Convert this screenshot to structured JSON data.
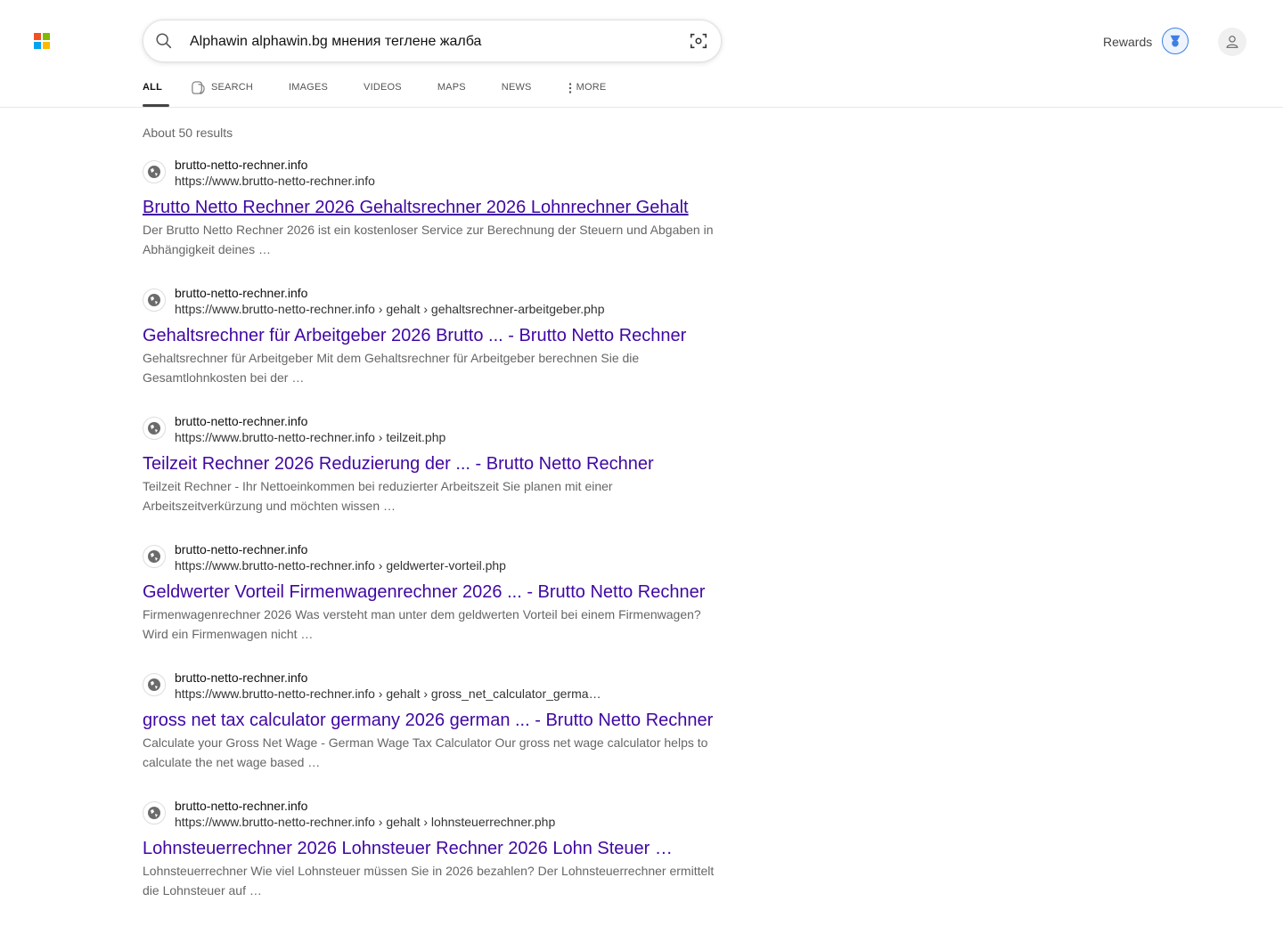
{
  "header": {
    "search_query": "Alphawin alphawin.bg мнения теглене жалба",
    "rewards_label": "Rewards"
  },
  "colors": {
    "logo": [
      "#f25022",
      "#7fba00",
      "#00a4ef",
      "#ffb900"
    ],
    "link": "#4007a2",
    "rewards_accent": "#3f7fe5"
  },
  "tabs": [
    {
      "label": "ALL",
      "icon": ""
    },
    {
      "label": "SEARCH",
      "icon": "copilot-icon"
    },
    {
      "label": "IMAGES",
      "icon": ""
    },
    {
      "label": "VIDEOS",
      "icon": ""
    },
    {
      "label": "MAPS",
      "icon": ""
    },
    {
      "label": "NEWS",
      "icon": ""
    },
    {
      "label": "MORE",
      "icon": "kebab-icon"
    }
  ],
  "results_count": "About 50 results",
  "results": [
    {
      "site": "brutto-netto-rechner.info",
      "url": "https://www.brutto-netto-rechner.info",
      "title": "Brutto Netto Rechner 2026 Gehaltsrechner 2026 Lohnrechner Gehalt",
      "snippet": "Der Brutto Netto Rechner 2026 ist ein kostenloser Service zur Berechnung der Steuern und Abgaben in Abhängigkeit deines …"
    },
    {
      "site": "brutto-netto-rechner.info",
      "url": "https://www.brutto-netto-rechner.info › gehalt › gehaltsrechner-arbeitgeber.php",
      "title": "Gehaltsrechner für Arbeitgeber 2026 Brutto ... - Brutto Netto Rechner",
      "snippet": "Gehaltsrechner für Arbeitgeber Mit dem Gehaltsrechner für Arbeitgeber berechnen Sie die Gesamtlohnkosten bei der …"
    },
    {
      "site": "brutto-netto-rechner.info",
      "url": "https://www.brutto-netto-rechner.info › teilzeit.php",
      "title": "Teilzeit Rechner 2026 Reduzierung der ... - Brutto Netto Rechner",
      "snippet": "Teilzeit Rechner - Ihr Nettoeinkommen bei reduzierter Arbeitszeit Sie planen mit einer Arbeitszeitverkürzung und möchten wissen …"
    },
    {
      "site": "brutto-netto-rechner.info",
      "url": "https://www.brutto-netto-rechner.info › geldwerter-vorteil.php",
      "title": "Geldwerter Vorteil Firmenwagenrechner 2026 ... - Brutto Netto Rechner",
      "snippet": "Firmenwagenrechner 2026 Was versteht man unter dem geldwerten Vorteil bei einem Firmenwagen? Wird ein Firmenwagen nicht …"
    },
    {
      "site": "brutto-netto-rechner.info",
      "url": "https://www.brutto-netto-rechner.info › gehalt › gross_net_calculator_germa…",
      "title": "gross net tax calculator germany 2026 german ... - Brutto Netto Rechner",
      "snippet": "Calculate your Gross Net Wage - German Wage Tax Calculator Our gross net wage calculator helps to calculate the net wage based …"
    },
    {
      "site": "brutto-netto-rechner.info",
      "url": "https://www.brutto-netto-rechner.info › gehalt › lohnsteuerrechner.php",
      "title": "Lohnsteuerrechner 2026 Lohnsteuer Rechner 2026 Lohn Steuer …",
      "snippet": "Lohnsteuerrechner Wie viel Lohnsteuer müssen Sie in 2026 bezahlen? Der Lohnsteuerrechner ermittelt die Lohnsteuer auf …"
    }
  ]
}
